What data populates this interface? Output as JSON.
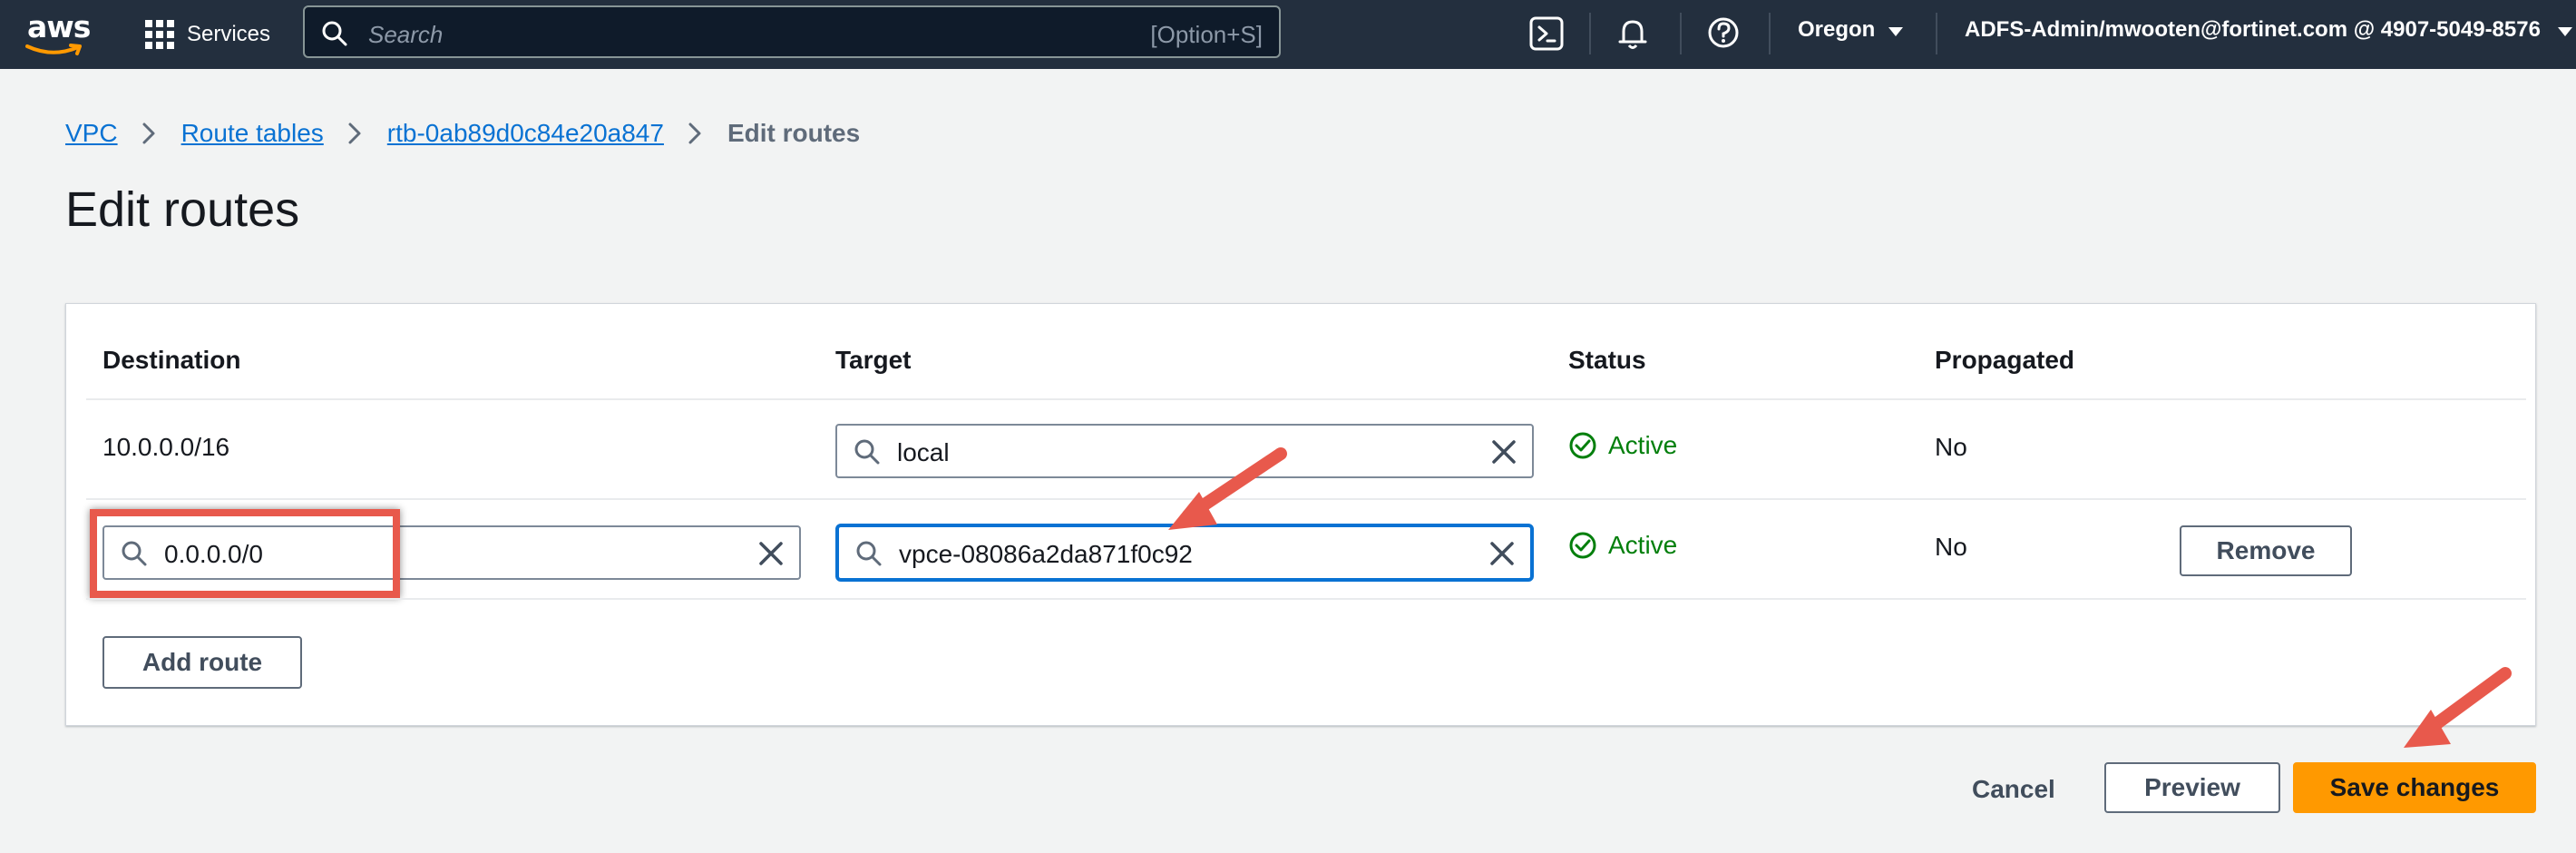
{
  "header": {
    "logo_text": "aws",
    "services_label": "Services",
    "search_placeholder": "Search",
    "search_shortcut": "[Option+S]",
    "region": "Oregon",
    "account": "ADFS-Admin/mwooten@fortinet.com @ 4907-5049-8576",
    "icons": [
      "cloudshell-icon",
      "notifications-bell-icon",
      "help-icon"
    ]
  },
  "breadcrumb": {
    "items": [
      "VPC",
      "Route tables",
      "rtb-0ab89d0c84e20a847"
    ],
    "current": "Edit routes"
  },
  "page_title": "Edit routes",
  "table": {
    "columns": [
      "Destination",
      "Target",
      "Status",
      "Propagated"
    ],
    "rows": [
      {
        "destination": "10.0.0.0/16",
        "target": "local",
        "status": "Active",
        "propagated": "No"
      },
      {
        "destination": "0.0.0.0/0",
        "target": "vpce-08086a2da871f0c92",
        "status": "Active",
        "propagated": "No",
        "remove_label": "Remove"
      }
    ],
    "add_route_label": "Add route"
  },
  "footer": {
    "cancel_label": "Cancel",
    "preview_label": "Preview",
    "save_label": "Save changes"
  },
  "colors": {
    "nav_bg": "#232f3e",
    "link": "#0972d3",
    "status_green": "#037f0c",
    "primary_orange": "#ff9900",
    "annotation_red": "#e8594c"
  }
}
